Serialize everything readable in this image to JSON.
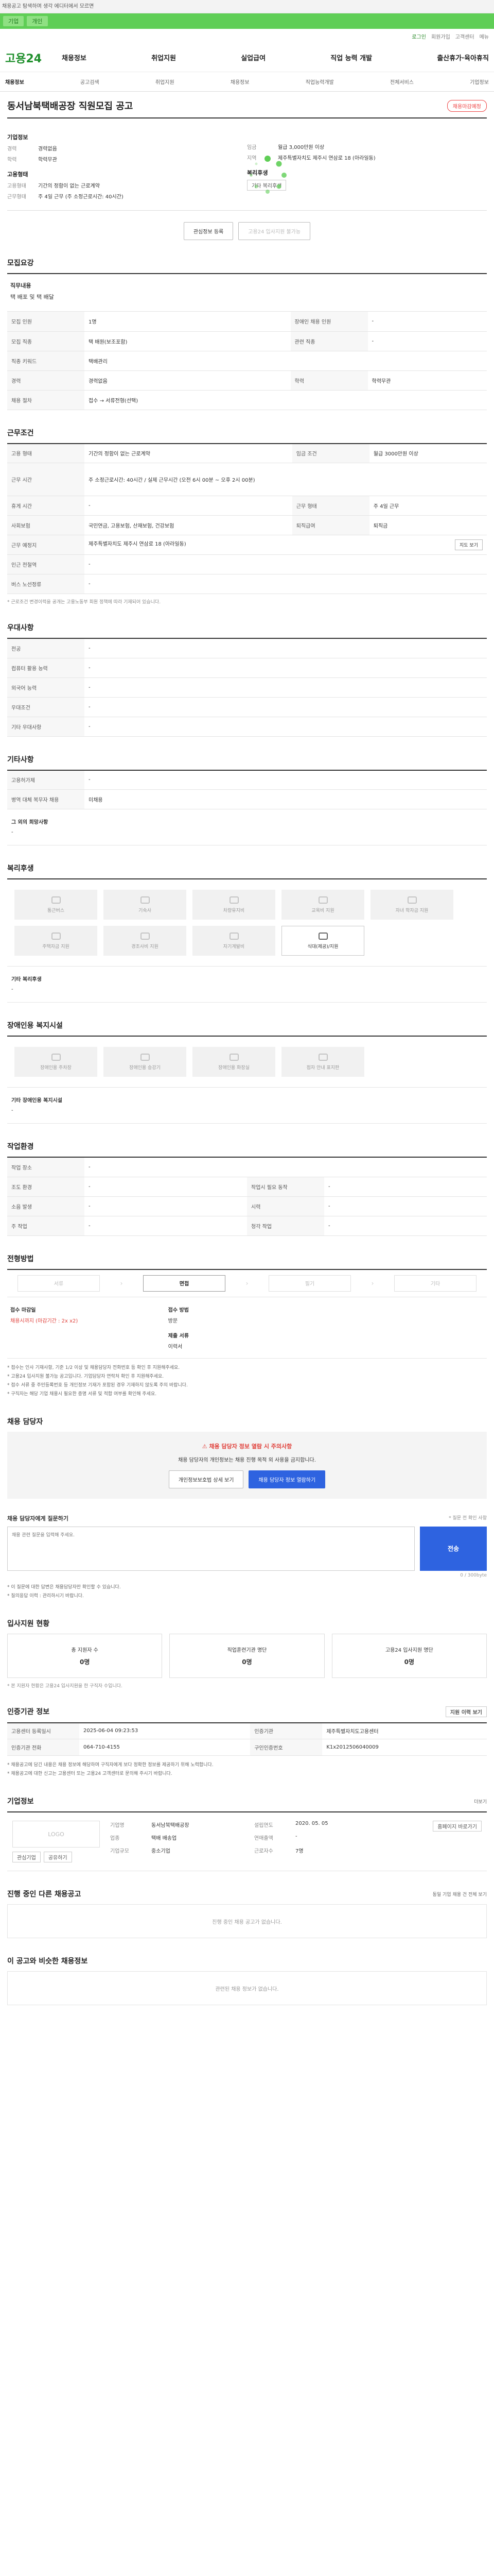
{
  "top_notice": "채용공고 탐색하며 생각 에디터에서 모르면",
  "strip": {
    "chip1": "기업",
    "chip2": "개인"
  },
  "util": {
    "items": [
      "로그인",
      "회원가입",
      "고객센터",
      "메뉴"
    ]
  },
  "header": {
    "logo": "고용24",
    "nav": [
      "채용정보",
      "취업지원",
      "실업급여",
      "직업 능력 개발",
      "출산휴가·육아휴직"
    ]
  },
  "subnav": [
    "채용정보",
    "공고검색",
    "취업지원",
    "채용정보",
    "직업능력개발",
    "전체서비스",
    "기업정보"
  ],
  "job": {
    "title": "동서남북택배공장 직원모집 공고",
    "badge": "채용마감예정",
    "company_label": "기업정보",
    "rows_left": [
      {
        "k": "경력",
        "v": "경력없음"
      },
      {
        "k": "학력",
        "v": "학력무관"
      }
    ],
    "rows_right": [
      {
        "k": "임금",
        "v": "월급 3,000만원 이상"
      },
      {
        "k": "지역",
        "v": "제주특별자치도 제주시 연삼로 18 (아라일동)"
      }
    ],
    "emp_label": "고용형태",
    "emp_rows": [
      {
        "k": "고용형태",
        "v": "기간의 정함이 없는 근로계약"
      },
      {
        "k": "근무형태",
        "v": "주 4일 근무 (주 소정근로시간: 40시간)"
      }
    ],
    "welfare_label": "복리후생",
    "welfare_box": "기타 복리후생",
    "action_apply": "관심정보 등록",
    "action_print": "고용24 입사지원 불가능"
  },
  "recruit": {
    "title": "모집요강",
    "desc_label": "직무내용",
    "desc_text": "택 배포 및 택 배달",
    "rows": [
      [
        "모집 인원",
        "1명",
        "장애인 채용 인원",
        "-"
      ],
      [
        "모집 직종",
        "택 배원(보조포함)",
        "관련 직종",
        "-"
      ],
      [
        "직종 키워드",
        "택배관리",
        "",
        ""
      ],
      [
        "경력",
        "경력없음",
        "학력",
        "학력무관"
      ],
      [
        "채용 절차",
        "접수 → 서류전형(선택)",
        "",
        ""
      ]
    ]
  },
  "work": {
    "title": "근무조건",
    "rows": [
      [
        "고용 형태",
        "기간의 정함이 없는 근로계약",
        "임금 조건",
        "월급 3000만원 이상"
      ],
      [
        "근무 시간",
        "주 소정근로시간: 40시간 / 실제 근무시간 (오전 6시 00분 ~ 오후 2시 00분)",
        "",
        ""
      ],
      [
        "휴게 시간",
        "-",
        "근무 형태",
        "주 4일 근무"
      ],
      [
        "사회보험",
        "국민연금, 고용보험, 산재보험, 건강보험",
        "퇴직급여",
        "퇴직금"
      ],
      [
        "근무 예정지",
        "제주특별자치도 제주시 연삼로 18 (아라일동)",
        "",
        ""
      ],
      [
        "인근 전철역",
        "-",
        "",
        ""
      ],
      [
        "버스 노선정류",
        "-",
        "",
        ""
      ]
    ],
    "map_btn": "지도 보기",
    "note": "* 근로조건 변경이력을 공개는 고용노동부 회원 정책에 따라 기재되어 있습니다."
  },
  "pref": {
    "title": "우대사항",
    "rows": [
      [
        "전공",
        "-"
      ],
      [
        "컴퓨터 활용 능력",
        "-"
      ],
      [
        "외국어 능력",
        "-"
      ],
      [
        "우대조건",
        "-"
      ],
      [
        "기타 우대사항",
        "-"
      ]
    ]
  },
  "etc": {
    "title": "기타사항",
    "rows": [
      [
        "고용허가제",
        "-"
      ],
      [
        "병역 대체 복무자 채용",
        "미채용"
      ]
    ],
    "other_label": "그 외의 희망사항",
    "other_value": "-"
  },
  "welfare": {
    "title": "복리후생",
    "items": [
      "통근버스",
      "기숙사",
      "차량유지비",
      "교육비 지원",
      "자녀 학자금 지원",
      "주택자금 지원",
      "경조사비 지원",
      "자기계발비",
      "식대(제공)/지원"
    ],
    "on_index": 8,
    "extra_label": "기타 복리후생",
    "extra_value": "-"
  },
  "disabled": {
    "title": "장애인용 복지시설",
    "items": [
      "장애인용 주차장",
      "장애인용 승강기",
      "장애인용 화장실",
      "점자 안내 표지판"
    ],
    "extra_label": "기타 장애인용 복지시설",
    "extra_value": "-"
  },
  "env": {
    "title": "작업환경",
    "rows": [
      [
        "작업 장소",
        "-",
        "",
        ""
      ],
      [
        "조도 환경",
        "-",
        "작업시 필요 동작",
        "-"
      ],
      [
        "소음 발생",
        "-",
        "시력",
        "-"
      ],
      [
        "주 작업",
        "-",
        "청각 작업",
        "-"
      ]
    ]
  },
  "process": {
    "title": "전형방법",
    "steps": [
      "서류",
      "면접",
      "필기",
      "기타"
    ],
    "on_index": 1,
    "deadline_label": "접수 마감일",
    "deadline_value": "채용시까지 (마감기간 : 2x x2)",
    "method_label": "접수 방법",
    "method_value": "방문",
    "docs_label": "제출 서류",
    "docs_value": "이력서",
    "bullets": [
      "* 접수는 인사 기재사항, 기준 1/2 이상 및 채용담당자 전화번호 등 확인 후 지원해주세요.",
      "* 고용24 입사지원 불가능 공고입니다. 기업담당자 연락처 확인 후 지원해주세요.",
      "* 접수 서류 중 주민등록번호 등 개인정보 기재가 포함된 경우 기재하지 않도록 주의 바랍니다.",
      "* 구직자는 해당 기업 채용시 필요한 증명 서류 및 적합 여부를 확인해 주세요."
    ]
  },
  "contact": {
    "title": "채용 담당자",
    "warn_head": "채용 담당자 정보 열람 시 주의사항",
    "warn_body": "채용 담당자의 개인정보는 채용 진행 목적 외 사용을 금지합니다.",
    "btn_privacy": "개인정보보호법 상세 보기",
    "btn_view": "채용 담당자 정보 열람하기",
    "inquiry_label": "채용 담당자에게 질문하기",
    "inquiry_hint": "* 질문 전 확인 사항",
    "inquiry_placeholder": "채용 관련 질문을 입력해 주세요.",
    "inquiry_send": "전송",
    "counter": "0 / 300byte",
    "notes": [
      "* 이 질문에 대한 답변은 채용담당자만 확인할 수 있습니다.",
      "* 질의응답 이력 : 관리하시기 바랍니다."
    ]
  },
  "stats": {
    "title": "입사지원 현황",
    "items": [
      {
        "label": "총 지원자 수",
        "value": "0명"
      },
      {
        "label": "직업훈련기관 명단",
        "value": "0명"
      },
      {
        "label": "고용24 입사지원 명단",
        "value": "0명"
      }
    ],
    "note": "* 본 지원자 현황은 고용24 입사지원을 한 구직자 수입니다."
  },
  "agency": {
    "title": "인증기관 정보",
    "right_btn": "지원 이력 보기",
    "rows": [
      [
        "고용센터 등록일시",
        "2025-06-04 09:23:53",
        "인증기관",
        "제주특별자치도고용센터"
      ],
      [
        "인증기관 전화",
        "064-710-4155",
        "구인인증번호",
        "K1x2012506040009"
      ]
    ],
    "bullets": [
      "* 채용공고에 담긴 내용은 채용 정보에 해당하며 구직자에게 보다 정확한 정보를 제공하기 위해 노력합니다.",
      "* 채용공고에 대한 신고는 고용센터 또는 고용24 고객센터로 문의해 주시기 바랍니다."
    ]
  },
  "company": {
    "title": "기업정보",
    "right_link": "더보기",
    "logo": "LOGO",
    "rows": [
      {
        "k1": "기업명",
        "v1": "동서남북택배공장",
        "k2": "설립연도",
        "v2": "2020. 05. 05"
      },
      {
        "k1": "업종",
        "v1": "택배 배송업",
        "k2": "연매출액",
        "v2": "-"
      },
      {
        "k1": "기업규모",
        "v1": "중소기업",
        "k2": "근로자수",
        "v2": "7명"
      }
    ],
    "btn_homepage": "홈페이지 바로가기",
    "btn_interest": "관심기업",
    "btn_share": "공유하기"
  },
  "ongoing": {
    "title": "진행 중인 다른 채용공고",
    "right_link": "동일 기업 채용 건 전체 보기",
    "empty": "진행 중인 채용 공고가 없습니다."
  },
  "ai": {
    "title": "이 공고와 비슷한 채용정보",
    "empty": "관련된 채용 정보가 없습니다."
  }
}
